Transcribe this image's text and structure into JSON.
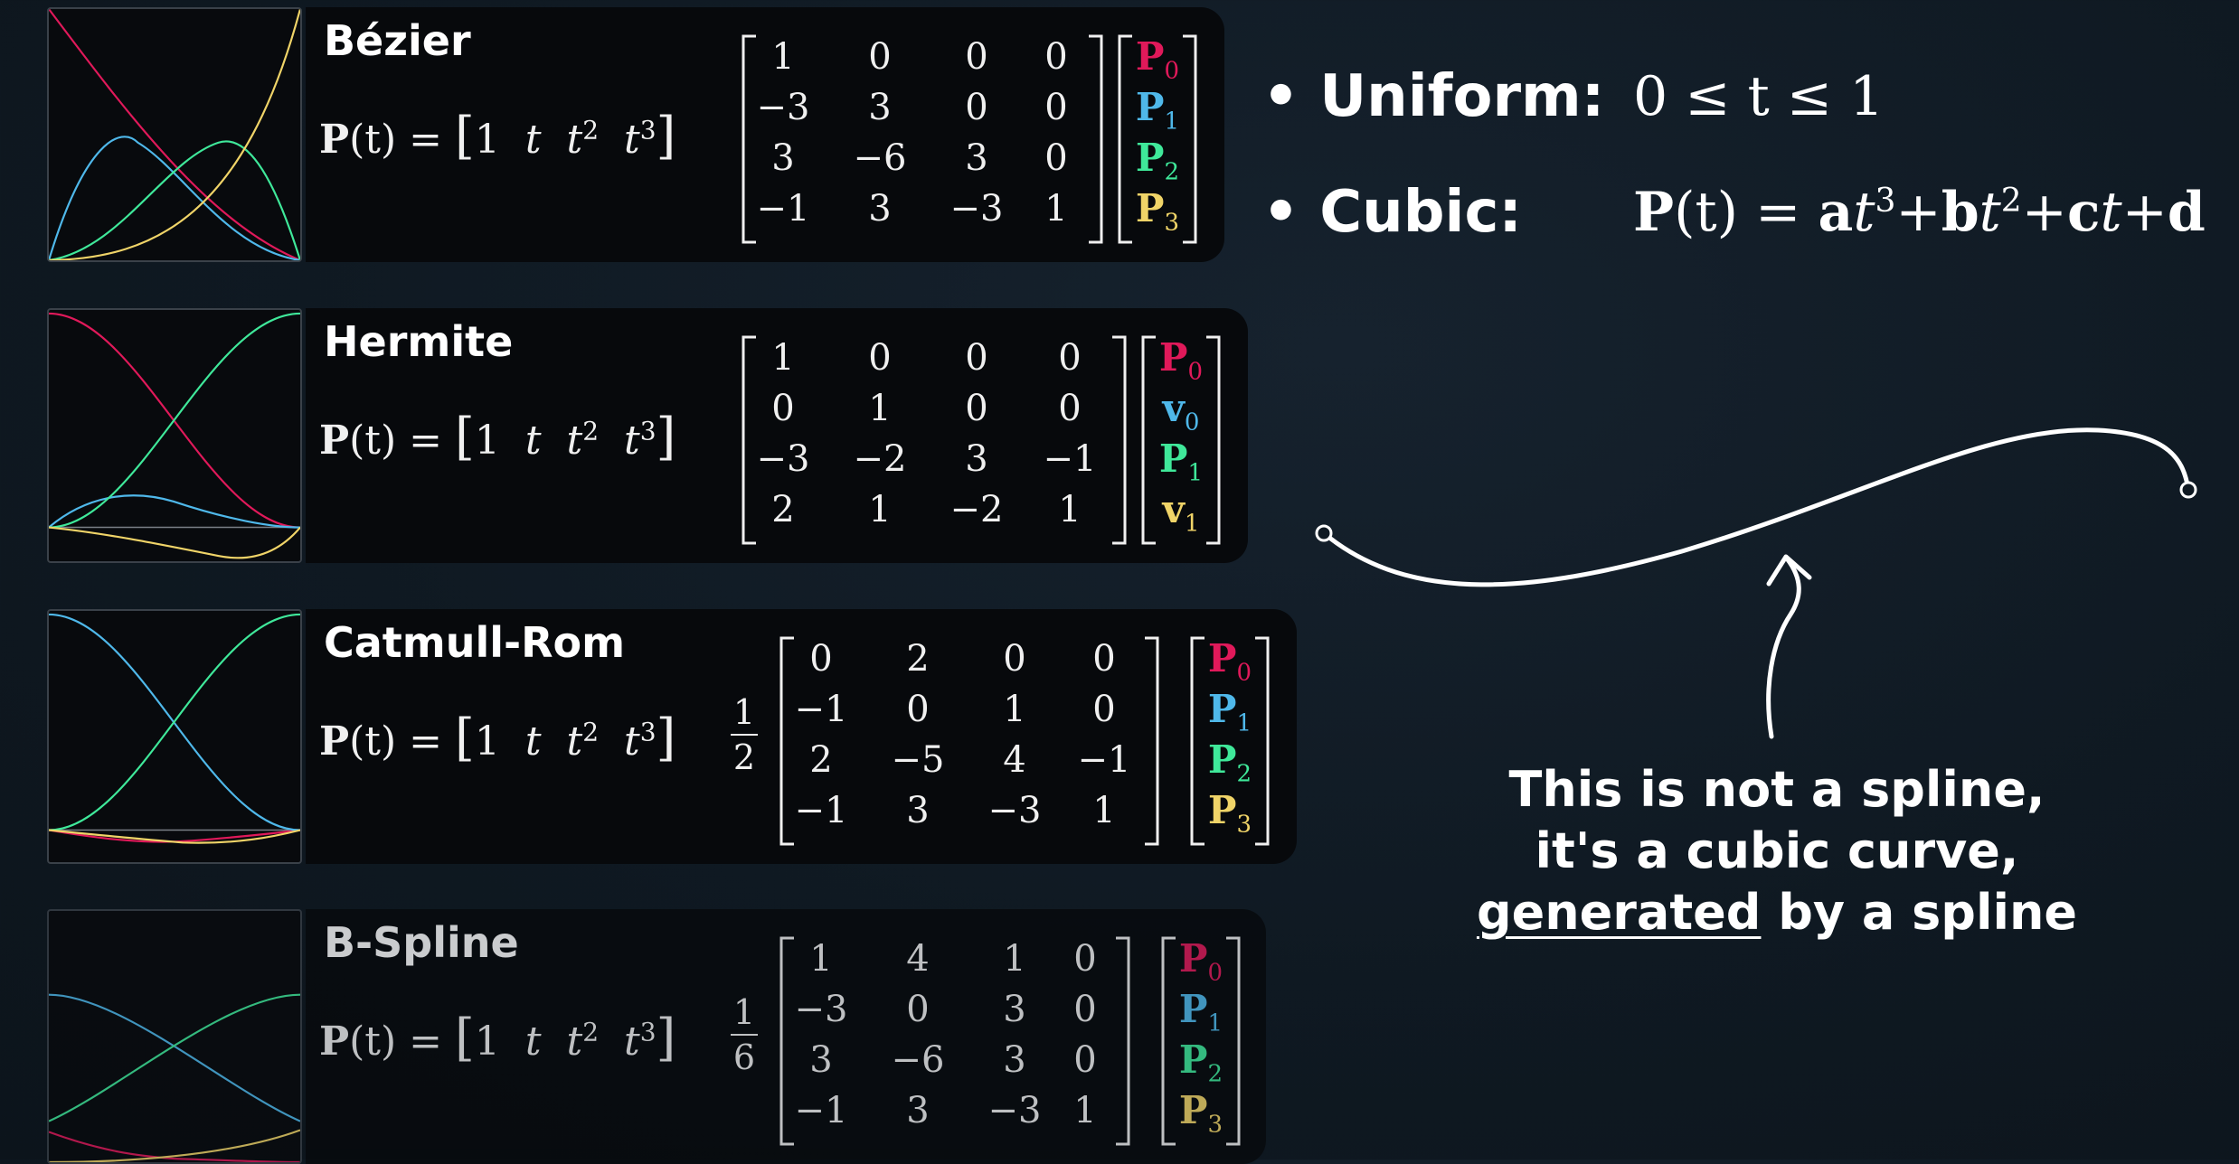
{
  "colors": {
    "p0": "#e0195a",
    "p1": "#4fb8ea",
    "p2": "#3fe89a",
    "p3": "#f0d468",
    "bg": "#0f1922",
    "card": "#07090c"
  },
  "formula": {
    "lhs": "P",
    "arg": "(t) =",
    "row": [
      "1",
      "t",
      "t",
      "t"
    ],
    "exps": [
      "2",
      "3"
    ]
  },
  "cards": [
    {
      "title": "Bézier",
      "matrix": [
        [
          "1",
          "0",
          "0",
          "0"
        ],
        [
          "−3",
          "3",
          "0",
          "0"
        ],
        [
          "3",
          "−6",
          "3",
          "0"
        ],
        [
          "−1",
          "3",
          "−3",
          "1"
        ]
      ],
      "vector": [
        {
          "sym": "P",
          "sub": "0"
        },
        {
          "sym": "P",
          "sub": "1"
        },
        {
          "sym": "P",
          "sub": "2"
        },
        {
          "sym": "P",
          "sub": "3"
        }
      ]
    },
    {
      "title": "Hermite",
      "matrix": [
        [
          "1",
          "0",
          "0",
          "0"
        ],
        [
          "0",
          "1",
          "0",
          "0"
        ],
        [
          "−3",
          "−2",
          "3",
          "−1"
        ],
        [
          "2",
          "1",
          "−2",
          "1"
        ]
      ],
      "vector": [
        {
          "sym": "P",
          "sub": "0"
        },
        {
          "sym": "v",
          "sub": "0"
        },
        {
          "sym": "P",
          "sub": "1"
        },
        {
          "sym": "v",
          "sub": "1"
        }
      ]
    },
    {
      "title": "Catmull-Rom",
      "fraction": {
        "num": "1",
        "den": "2"
      },
      "matrix": [
        [
          "0",
          "2",
          "0",
          "0"
        ],
        [
          "−1",
          "0",
          "1",
          "0"
        ],
        [
          "2",
          "−5",
          "4",
          "−1"
        ],
        [
          "−1",
          "3",
          "−3",
          "1"
        ]
      ],
      "vector": [
        {
          "sym": "P",
          "sub": "0"
        },
        {
          "sym": "P",
          "sub": "1"
        },
        {
          "sym": "P",
          "sub": "2"
        },
        {
          "sym": "P",
          "sub": "3"
        }
      ]
    },
    {
      "title": "B-Spline",
      "fraction": {
        "num": "1",
        "den": "6"
      },
      "matrix": [
        [
          "1",
          "4",
          "1",
          "0"
        ],
        [
          "−3",
          "0",
          "3",
          "0"
        ],
        [
          "3",
          "−6",
          "3",
          "0"
        ],
        [
          "−1",
          "3",
          "−3",
          "1"
        ]
      ],
      "vector": [
        {
          "sym": "P",
          "sub": "0"
        },
        {
          "sym": "P",
          "sub": "1"
        },
        {
          "sym": "P",
          "sub": "2"
        },
        {
          "sym": "P",
          "sub": "3"
        }
      ]
    }
  ],
  "bullets": {
    "uniform": {
      "label": "Uniform:",
      "math": "0 ≤ t ≤ 1"
    },
    "cubic": {
      "label": "Cubic:",
      "lhs": "P",
      "arg": "(t) = ",
      "a": "a",
      "t1": "t",
      "e3": "3",
      "plus": "+",
      "b": "b",
      "t2": "t",
      "e2": "2",
      "c": "c",
      "t3": "t",
      "d": "d"
    }
  },
  "note": {
    "line1": "This is not a spline,",
    "line2": "it's a cubic curve,",
    "line3_underlined": "generated",
    "line3_rest": " by a spline"
  }
}
